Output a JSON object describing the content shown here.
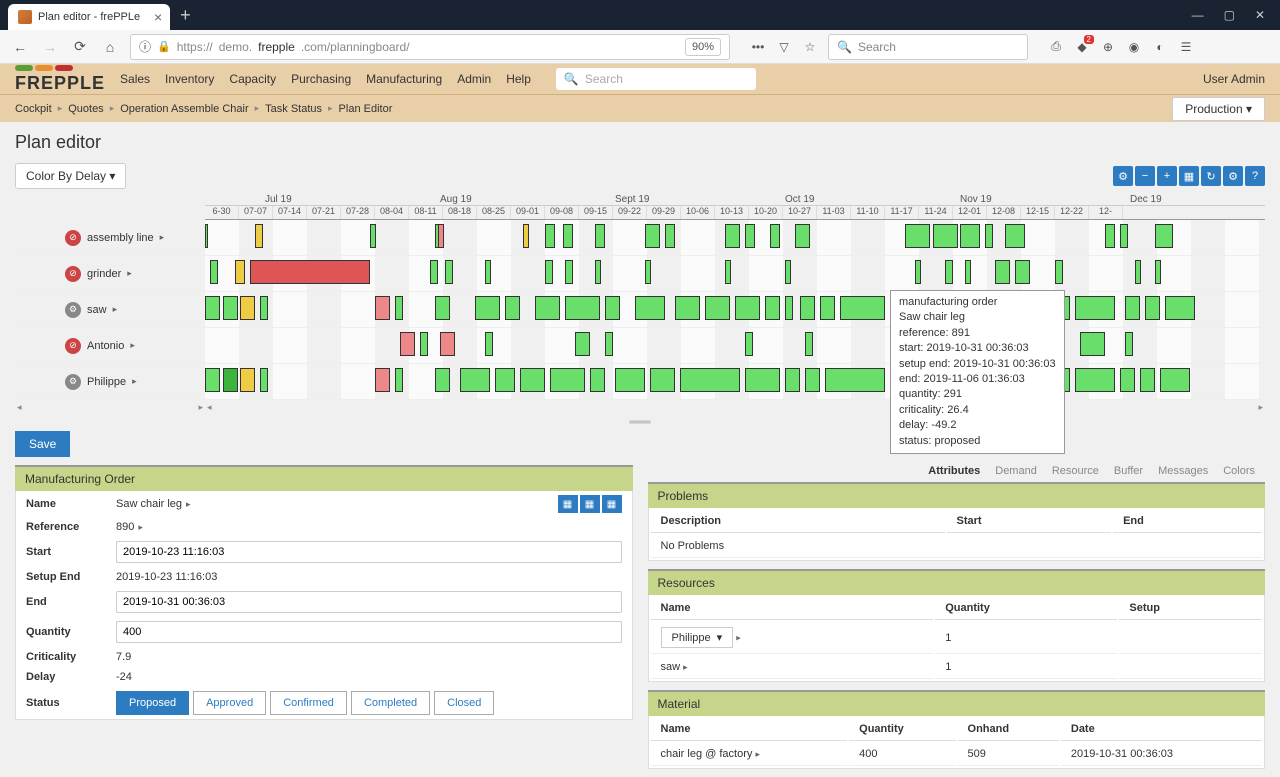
{
  "browser": {
    "tab_title": "Plan editor - frePPLe",
    "url": "https://demo.frepple.com/planningboard/",
    "url_display_prefix": "https://",
    "url_host": "demo.",
    "url_host2": "frepple",
    "url_path": ".com/planningboard/",
    "zoom": "90%",
    "search_placeholder": "Search",
    "notification_count": "2"
  },
  "header": {
    "logo": "FREPPLE",
    "menu": [
      "Sales",
      "Inventory",
      "Capacity",
      "Purchasing",
      "Manufacturing",
      "Admin",
      "Help"
    ],
    "search_placeholder": "Search",
    "user": "User Admin"
  },
  "breadcrumb": [
    "Cockpit",
    "Quotes",
    "Operation Assemble Chair",
    "Task Status",
    "Plan Editor"
  ],
  "production_dropdown": "Production",
  "page_title": "Plan editor",
  "color_by": "Color By Delay",
  "timeline": {
    "months": [
      "Jul 19",
      "Aug 19",
      "Sept 19",
      "Oct 19",
      "Nov 19",
      "Dec 19"
    ],
    "days": [
      "6-30",
      "07-07",
      "07-14",
      "07-21",
      "07-28",
      "08-04",
      "08-11",
      "08-18",
      "08-25",
      "09-01",
      "09-08",
      "09-15",
      "09-22",
      "09-29",
      "10-06",
      "10-13",
      "10-20",
      "10-27",
      "11-03",
      "11-10",
      "11-17",
      "11-24",
      "12-01",
      "12-08",
      "12-15",
      "12-22",
      "12-"
    ]
  },
  "resources": [
    {
      "name": "assembly line",
      "icon": "red"
    },
    {
      "name": "grinder",
      "icon": "red"
    },
    {
      "name": "saw",
      "icon": "gear"
    },
    {
      "name": "Antonio",
      "icon": "red"
    },
    {
      "name": "Philippe",
      "icon": "gear"
    }
  ],
  "tooltip": {
    "title": "manufacturing order",
    "item": "Saw chair leg",
    "reference": "reference: 891",
    "start": "start: 2019-10-31 00:36:03",
    "setup_end": "setup end: 2019-10-31 00:36:03",
    "end": "end: 2019-11-06 01:36:03",
    "quantity": "quantity: 291",
    "criticality": "criticality: 26.4",
    "delay": "delay: -49.2",
    "status": "status: proposed"
  },
  "save": "Save",
  "mo_panel": {
    "title": "Manufacturing Order",
    "labels": {
      "name": "Name",
      "reference": "Reference",
      "start": "Start",
      "setup_end": "Setup End",
      "end": "End",
      "quantity": "Quantity",
      "criticality": "Criticality",
      "delay": "Delay",
      "status": "Status"
    },
    "values": {
      "name": "Saw chair leg",
      "reference": "890",
      "start": "2019-10-23 11:16:03",
      "setup_end": "2019-10-23 11:16:03",
      "end": "2019-10-31 00:36:03",
      "quantity": "400",
      "criticality": "7.9",
      "delay": "-24"
    },
    "statuses": [
      "Proposed",
      "Approved",
      "Confirmed",
      "Completed",
      "Closed"
    ]
  },
  "right_tabs": [
    "Attributes",
    "Demand",
    "Resource",
    "Buffer",
    "Messages",
    "Colors"
  ],
  "problems_panel": {
    "title": "Problems",
    "cols": [
      "Description",
      "Start",
      "End"
    ],
    "empty": "No Problems"
  },
  "resources_panel": {
    "title": "Resources",
    "cols": [
      "Name",
      "Quantity",
      "Setup"
    ],
    "rows": [
      {
        "name": "Philippe",
        "quantity": "1",
        "setup": ""
      },
      {
        "name": "saw",
        "quantity": "1",
        "setup": ""
      }
    ]
  },
  "material_panel": {
    "title": "Material",
    "cols": [
      "Name",
      "Quantity",
      "Onhand",
      "Date"
    ],
    "rows": [
      {
        "name": "chair leg @ factory",
        "quantity": "400",
        "onhand": "509",
        "date": "2019-10-31 00:36:03"
      }
    ]
  }
}
